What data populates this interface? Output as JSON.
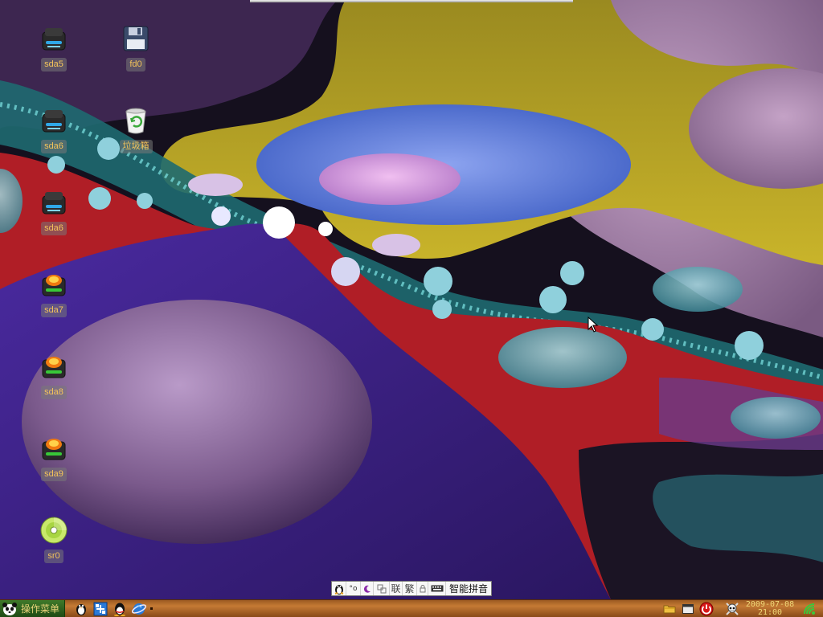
{
  "desktop": {
    "icons": [
      {
        "label": "sda5",
        "icon": "hard-drive-icon"
      },
      {
        "label": "sda6",
        "icon": "hard-drive-icon"
      },
      {
        "label": "sda6",
        "icon": "hard-drive-icon"
      },
      {
        "label": "sda7",
        "icon": "hard-drive-icon"
      },
      {
        "label": "sda8",
        "icon": "hard-drive-icon"
      },
      {
        "label": "sda9",
        "icon": "hard-drive-icon"
      },
      {
        "label": "sr0",
        "icon": "cd-drive-icon"
      },
      {
        "label": "fd0",
        "icon": "floppy-disk-icon"
      },
      {
        "label": "垃圾箱",
        "icon": "trash-icon"
      }
    ]
  },
  "ime": {
    "items": [
      "联",
      "繁"
    ],
    "mode": "智能拼音"
  },
  "taskbar": {
    "start_label": "操作菜单",
    "quick_launch": [
      "penguin-icon",
      "network-icon",
      "qq-icon",
      "browser-icon"
    ],
    "tray": [
      "folder-icon",
      "window-icon",
      "power-icon",
      "skull-icon",
      "network-status-icon"
    ]
  },
  "clock": {
    "date": "2009-07-08",
    "time": "21:00"
  },
  "colors": {
    "taskbar": "#b56c2c",
    "start": "#2f6a20",
    "label_text": "#f3c35a"
  }
}
